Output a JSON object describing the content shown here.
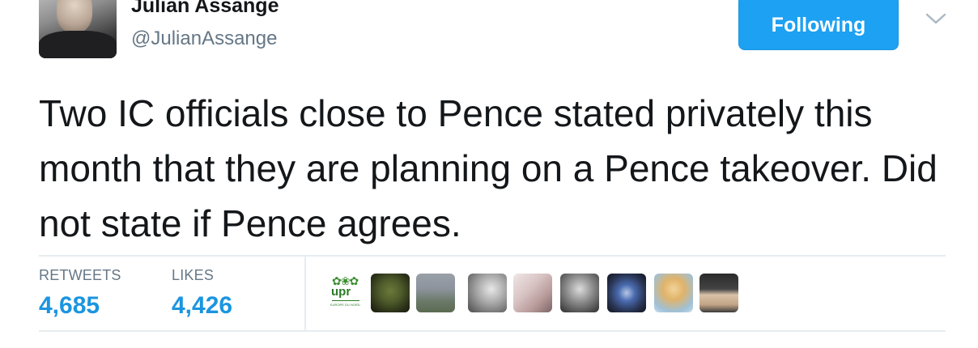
{
  "author": {
    "name": "Julian Assange",
    "handle": "@JulianAssange"
  },
  "follow_button": {
    "label": "Following",
    "color": "#1da1f2"
  },
  "more_menu": {
    "icon": "chevron-down-icon"
  },
  "tweet": {
    "text": "Two IC officials close to Pence stated privately this month that they are planning on a Pence takeover. Did not state if Pence agrees."
  },
  "stats": {
    "retweets_label": "RETWEETS",
    "retweets_value": "4,685",
    "likes_label": "LIKES",
    "likes_value": "4,426"
  },
  "likers": {
    "first_logo": {
      "brand": "upr",
      "subtext": "EUROPE DU NORD"
    },
    "count_shown": 9
  }
}
